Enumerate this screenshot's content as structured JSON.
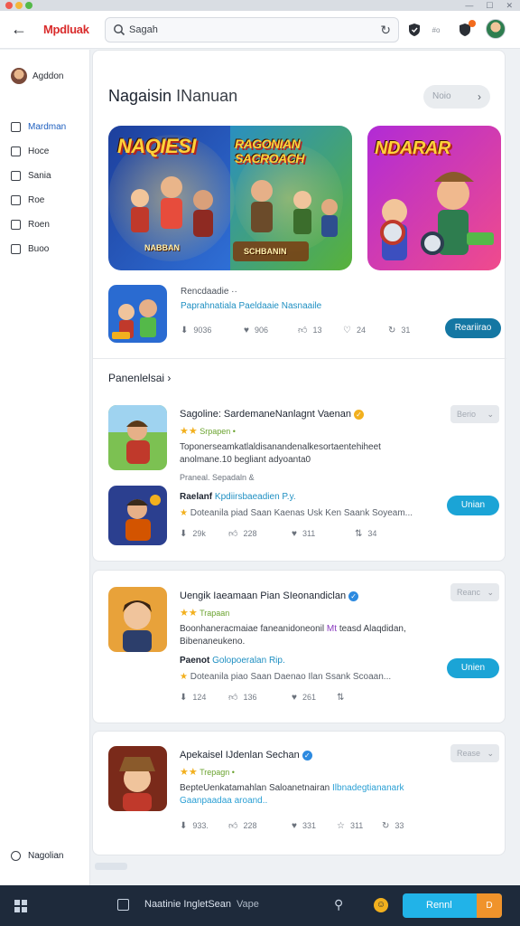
{
  "window": {
    "controls": [
      "—",
      "☐",
      "✕"
    ]
  },
  "topbar": {
    "brand": "Mpdluak",
    "search_value": "Sagah",
    "icon_label": "#o"
  },
  "sidebar": {
    "user_name": "Agddon",
    "items": [
      {
        "label": "Mardman",
        "icon": "home-icon"
      },
      {
        "label": "Hoce",
        "icon": "edit-icon"
      },
      {
        "label": "Sania",
        "icon": "share-icon"
      },
      {
        "label": "Roe",
        "icon": "pencil-icon"
      },
      {
        "label": "Roen",
        "icon": "square-icon"
      },
      {
        "label": "Buoo",
        "icon": "doc-icon"
      }
    ],
    "bottom_label": "Nagolian"
  },
  "hero": {
    "title": "Nagaisin",
    "title_sub": "INanuan",
    "see_all": "Noio",
    "banner_a_left": "NAQIESI",
    "banner_a_left_caption": "NABBAN",
    "banner_a_right": "RAGONIAN SACROACH",
    "banner_a_right_caption": "SCHBANIN",
    "banner_b": "NDARAR"
  },
  "featured": {
    "name": "Rencdaadie  ··",
    "desc": "Paprahnatiala Paeldaaie Nasnaaile",
    "stats": [
      "9036",
      "906",
      "13",
      "24",
      "31"
    ],
    "button": "Reariirao"
  },
  "section_title": "Panenlelsai ›",
  "apps": [
    {
      "title": "Sagoline: SardemaneNanlagnt  Vaenan",
      "rating_label": "Srpapen  •",
      "desc_line1": "Toponerseamkatlaldisanandenalkesortaentehiheet",
      "desc_line2": "anolmane.10  begliant  adyoanta0",
      "meta": "Praneal.  Sepadaln  &",
      "sub_bold": "Raelanf",
      "sub_link": "Kpdiirsbaeadien  P.y.",
      "star_line": "Doteanila  piad Saan  Kaenas  Usk  Ken  Saank  Soyeam...",
      "stats": [
        "29k",
        "228",
        "311",
        "34"
      ],
      "get": "Berio",
      "button": "Unian"
    },
    {
      "title": "Uengik Iaeamaan Pian SIeonandiclan",
      "rating_label": "Trapaan",
      "desc_line1": "Boonhaneracmaiae faneanidoneonil",
      "desc_hl": "Mt",
      "desc_line1b": "teasd Alaqdidan,",
      "desc_line2": "Bibenaneukeno.",
      "sub_bold": "Paenot",
      "sub_link": "Golopoeralan Rip.",
      "star_line": "Doteanila  piao Saan  Daenao  Ilan  Ssank  Scoaan...",
      "stats": [
        "124",
        "136",
        "261",
        ""
      ],
      "get": "Reanc",
      "button": "Unien"
    },
    {
      "title": "Apekaisel IJdenlan Sechan",
      "rating_label": "Trepagn  •",
      "desc_line1": "BepteUenkatamahlan Saloanetnairan",
      "desc_hl": "Ilbnadegtiananark",
      "desc_line2": "Gaanpaadaa aroand..",
      "stats": [
        "933.",
        "228",
        "331",
        "311",
        "33"
      ],
      "get": "Rease"
    }
  ],
  "taskbar": {
    "title": "Naatinie IngletSean",
    "sub": "Vape",
    "button": "Rennl"
  },
  "colors": {
    "accent": "#1ba4d6",
    "brand": "#d92b2b",
    "dark_button": "#1477a3",
    "taskbar": "#1e2a3b"
  }
}
